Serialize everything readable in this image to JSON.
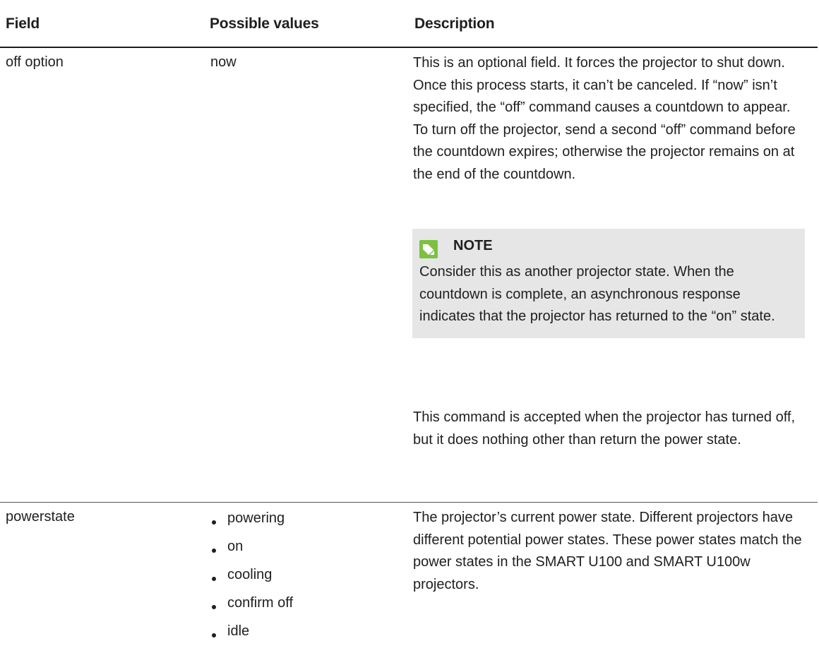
{
  "table": {
    "headers": {
      "field": "Field",
      "values": "Possible values",
      "description": "Description"
    },
    "rows": [
      {
        "field": "off option",
        "value": "now",
        "description": "This is an optional field. It forces the projector to shut down. Once this process starts, it can’t be canceled. If “now” isn’t specified, the “off” command causes a countdown to appear. To turn off the projector, send a second “off” command before the countdown expires; otherwise the projector remains on at the end of the countdown.",
        "note": {
          "icon": "pencil-icon",
          "title": "NOTE",
          "text": "Consider this as another projector state. When the countdown is complete, an asynchronous response indicates that the projector has returned to the “on” state."
        },
        "description_after": "This command is accepted when the projector has turned off, but it does nothing other than return the power state."
      },
      {
        "field": "powerstate",
        "values": [
          "powering",
          "on",
          "cooling",
          "confirm off",
          "idle"
        ],
        "description": "The projector’s current power state. Different projectors have different potential power states. These power states match the power states in the SMART U100 and SMART U100w projectors."
      }
    ]
  },
  "colors": {
    "note_background": "#e6e6e6",
    "note_icon": "#7cc142",
    "rule": "#1a1a1a"
  }
}
